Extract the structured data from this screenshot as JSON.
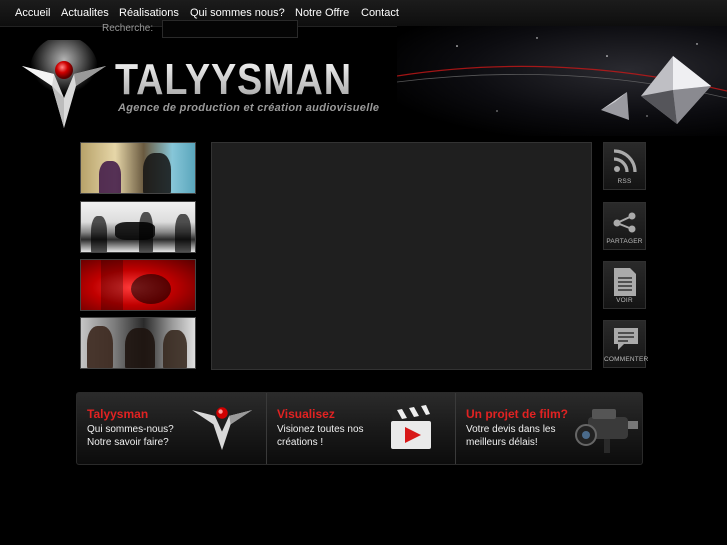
{
  "nav": {
    "items": [
      "Accueil",
      "Actualites",
      "Réalisations",
      "Qui sommes nous?",
      "Notre Offre",
      "Contact"
    ]
  },
  "search": {
    "label": "Recherche:",
    "value": ""
  },
  "brand": {
    "name": "TALYYSMAN",
    "tagline": "Agence de production et création audiovisuelle",
    "accent": "#e12222"
  },
  "side": {
    "rss": "RSS",
    "share": "PARTAGER",
    "view": "VOIR",
    "comment": "COMMENTER"
  },
  "promos": [
    {
      "title": "Talyysman",
      "line1": "Qui sommes-nous?",
      "line2": "Notre savoir faire?",
      "icon": "logo-icon"
    },
    {
      "title": "Visualisez",
      "line1": "Visionez toutes nos",
      "line2": "créations !",
      "icon": "clapperboard-icon"
    },
    {
      "title": "Un projet de film?",
      "line1": "Votre devis dans les",
      "line2": "meilleurs délais!",
      "icon": "camera-icon"
    }
  ]
}
